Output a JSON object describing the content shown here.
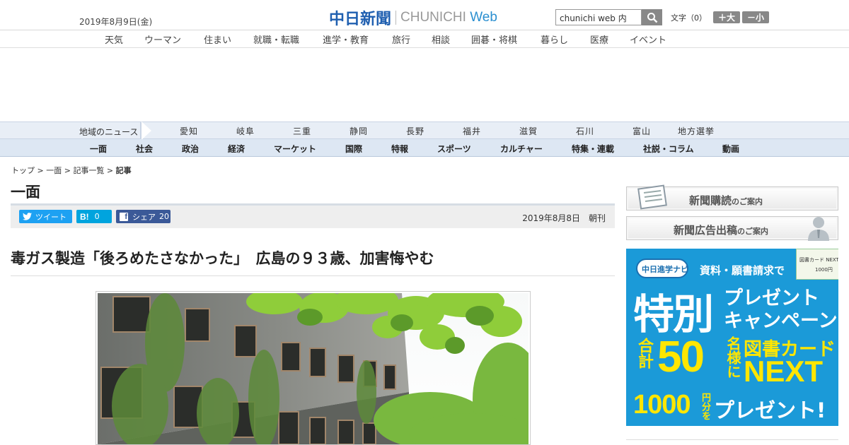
{
  "header": {
    "date": "2019年8月9日(金)",
    "logo_ja": "中日新聞",
    "logo_en_a": "CHUNICHI ",
    "logo_en_b": "Web",
    "search_value": "chunichi web 内",
    "font_size_label": "文字（0）",
    "font_bigger": "＋大",
    "font_smaller": "－小"
  },
  "topnav": [
    "天気",
    "ウーマン",
    "住まい",
    "就職・転職",
    "進学・教育",
    "旅行",
    "相談",
    "囲碁・将棋",
    "暮らし",
    "医療",
    "イベント"
  ],
  "regionbar": {
    "label": "地域のニュース",
    "items": [
      "愛知",
      "岐阜",
      "三重",
      "静岡",
      "長野",
      "福井",
      "滋賀",
      "石川",
      "富山",
      "地方選挙"
    ]
  },
  "catbar": [
    "一面",
    "社会",
    "政治",
    "経済",
    "マーケット",
    "国際",
    "特報",
    "スポーツ",
    "カルチャー",
    "特集・連載",
    "社説・コラム",
    "動画"
  ],
  "breadcrumb": {
    "top": "トップ",
    "sep": " > ",
    "page": "一面",
    "list": "記事一覧",
    "current": "記事"
  },
  "section_title": "一面",
  "share": {
    "tweet": "ツイート",
    "hatena_count": "0",
    "fb_label": "シェア",
    "fb_count": "20"
  },
  "pubdate": "2019年8月8日　朝刊",
  "headline": "毒ガス製造「後ろめたさなかった」　広島の９３歳、加害悔やむ",
  "sidebar": {
    "subscribe_main": "新聞購読",
    "subscribe_sub": "のご案内",
    "ad_main": "新聞広告出稿",
    "ad_sub": "のご案内"
  },
  "banner": {
    "navi": "中日進学ナビ",
    "top": "資料・願書請求で",
    "tokubetsu": "特別",
    "present1": "プレゼント",
    "campaign": "キャンペーン",
    "gokei": "合計",
    "num": "50",
    "meisama": "名様に",
    "card": "図書カード",
    "next": "NEXT",
    "yen": "1000",
    "enbun": "円分を",
    "present2": "プレゼント!",
    "card_label": "図書カード NEXT",
    "card_amount": "1000円"
  },
  "colors": {
    "accent": "#1f5fb0",
    "twitter": "#1da1f2",
    "hatena": "#00a4de",
    "facebook": "#3b5998",
    "banner": "#1b9ad8"
  }
}
